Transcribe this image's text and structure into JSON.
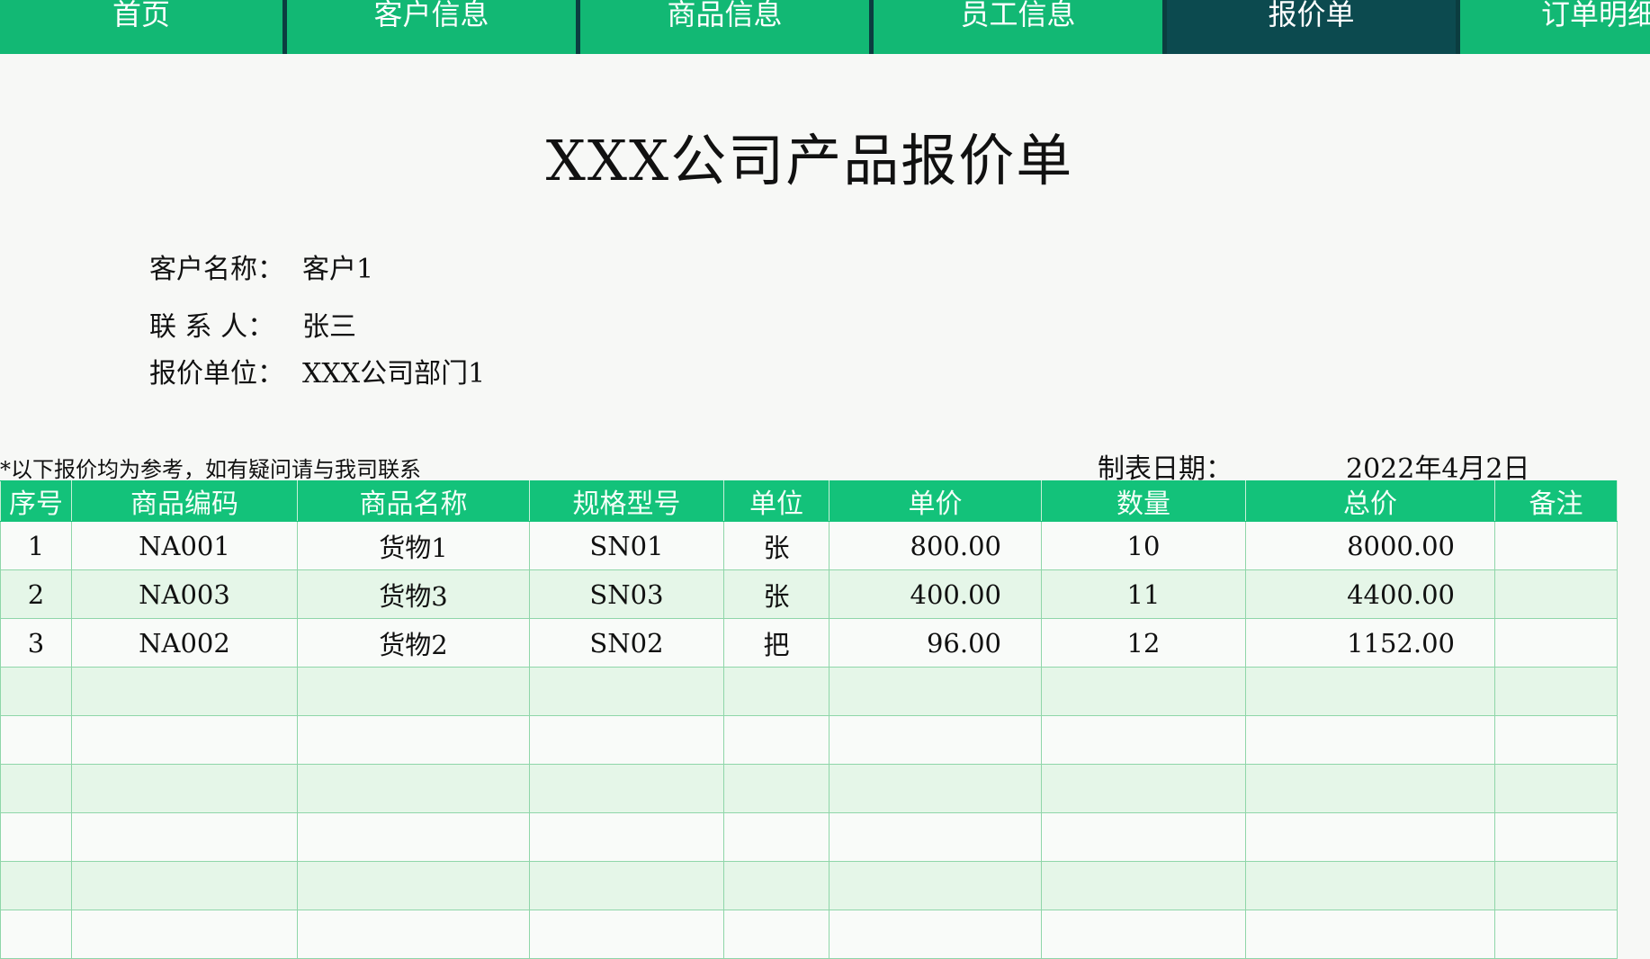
{
  "nav": {
    "tabs": [
      {
        "label": "首页",
        "active": false
      },
      {
        "label": "客户信息",
        "active": false
      },
      {
        "label": "商品信息",
        "active": false
      },
      {
        "label": "员工信息",
        "active": false
      },
      {
        "label": "报价单",
        "active": true
      },
      {
        "label": "订单明细",
        "active": false
      }
    ]
  },
  "page": {
    "title": "XXX公司产品报价单"
  },
  "info": {
    "customer_label": "客户名称：",
    "customer_value": "客户1",
    "contact_label": "联 系 人：",
    "contact_value": "张三",
    "unit_label": "报价单位：",
    "unit_value": "XXX公司部门1"
  },
  "note": "*以下报价均为参考，如有疑问请与我司联系",
  "date": {
    "label": "制表日期：",
    "value": "2022年4月2日"
  },
  "table": {
    "headers": [
      "序号",
      "商品编码",
      "商品名称",
      "规格型号",
      "单位",
      "单价",
      "数量",
      "总价",
      "备注"
    ],
    "rows": [
      [
        "1",
        "NA001",
        "货物1",
        "SN01",
        "张",
        "800.00",
        "10",
        "8000.00",
        ""
      ],
      [
        "2",
        "NA003",
        "货物3",
        "SN03",
        "张",
        "400.00",
        "11",
        "4400.00",
        ""
      ],
      [
        "3",
        "NA002",
        "货物2",
        "SN02",
        "把",
        "96.00",
        "12",
        "1152.00",
        ""
      ],
      [
        "",
        "",
        "",
        "",
        "",
        "",
        "",
        "",
        ""
      ],
      [
        "",
        "",
        "",
        "",
        "",
        "",
        "",
        "",
        ""
      ],
      [
        "",
        "",
        "",
        "",
        "",
        "",
        "",
        "",
        ""
      ],
      [
        "",
        "",
        "",
        "",
        "",
        "",
        "",
        "",
        ""
      ],
      [
        "",
        "",
        "",
        "",
        "",
        "",
        "",
        "",
        ""
      ],
      [
        "",
        "",
        "",
        "",
        "",
        "",
        "",
        "",
        ""
      ]
    ]
  },
  "colors": {
    "tab": "#12b874",
    "tab_active": "#0c4a4f",
    "header": "#13c27a",
    "row_alt": "#e5f6e8"
  }
}
